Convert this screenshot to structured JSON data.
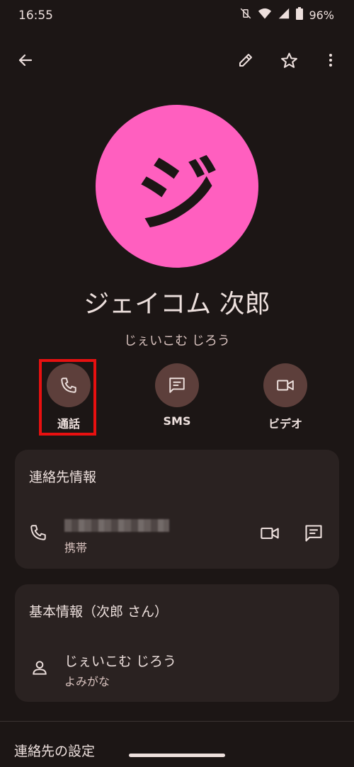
{
  "status_bar": {
    "time": "16:55",
    "battery": "96%"
  },
  "contact": {
    "name": "ジェイコム 次郎",
    "reading": "じぇいこむ じろう",
    "avatar_initial": "ジ"
  },
  "actions": [
    {
      "label": "通話",
      "icon": "phone-icon"
    },
    {
      "label": "SMS",
      "icon": "message-icon"
    },
    {
      "label": "ビデオ",
      "icon": "video-icon"
    }
  ],
  "contact_info": {
    "title": "連絡先情報",
    "phone_type": "携帯"
  },
  "basic_info": {
    "title": "基本情報（次郎 さん）",
    "reading_value": "じぇいこむ じろう",
    "reading_label": "よみがな"
  },
  "settings": {
    "title": "連絡先の設定"
  },
  "colors": {
    "background": "#1c1615",
    "avatar": "#ff5fbf",
    "action_circle": "#5d3f3b",
    "highlight": "#e81010"
  }
}
